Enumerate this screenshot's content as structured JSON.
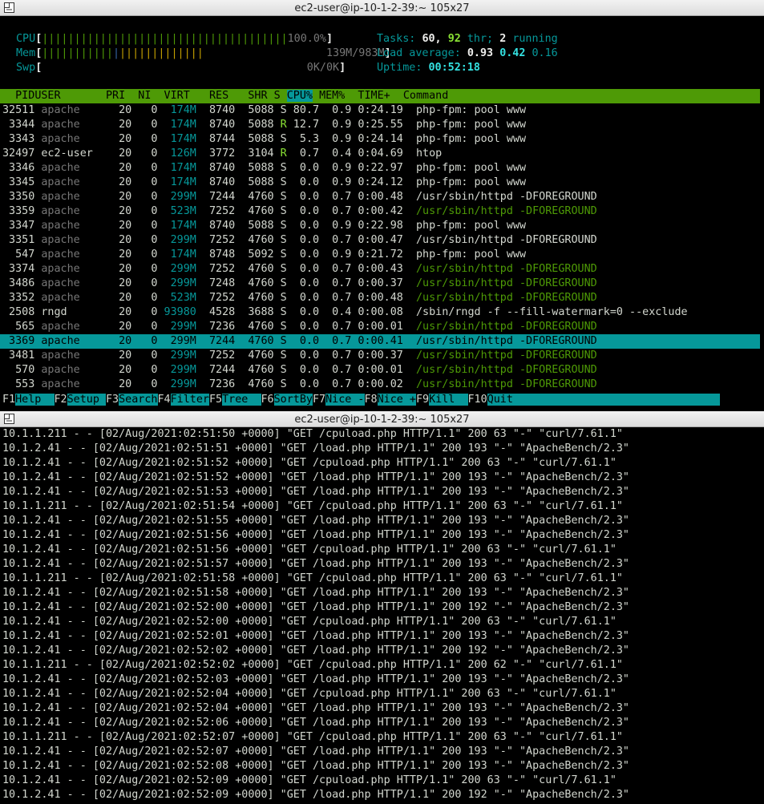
{
  "windows": [
    {
      "title": "ec2-user@ip-10-1-2-39:~ 105x27"
    },
    {
      "title": "ec2-user@ip-10-1-2-39:~ 105x27"
    }
  ],
  "htop": {
    "meters": {
      "cpu": {
        "label": "CPU",
        "bar": "||||||||||||||||||||||||||||||||||||||",
        "value": "100.0%"
      },
      "mem": {
        "label": "Mem",
        "bar_green": "|||||||||||",
        "bar_blue": "|",
        "bar_yellow": "|||||||||||||",
        "value": "139M/983M"
      },
      "swp": {
        "label": "Swp",
        "value": "0K/0K"
      }
    },
    "tasks": {
      "label": "Tasks:",
      "count": "60,",
      "threads": "92",
      "thr_label": "thr;",
      "running": "2",
      "running_label": "running"
    },
    "load": {
      "label": "Load average:",
      "one": "0.93",
      "five": "0.42",
      "fifteen": "0.16"
    },
    "uptime": {
      "label": "Uptime:",
      "value": "00:52:18"
    },
    "columns": [
      "  PID",
      "USER     ",
      "  PRI",
      "  NI",
      "  VIRT",
      "   RES",
      "   SHR",
      " S",
      "CPU%",
      "MEM%",
      "  TIME+ ",
      " Command"
    ],
    "processes": [
      [
        "32511",
        "apache",
        "20",
        "0",
        "174M",
        "8740",
        "5088",
        "S",
        "80.7",
        "0.9",
        "0:24.19",
        "php-fpm: pool www"
      ],
      [
        "3344",
        "apache",
        "20",
        "0",
        "174M",
        "8740",
        "5088",
        "R",
        "12.7",
        "0.9",
        "0:25.55",
        "php-fpm: pool www"
      ],
      [
        "3343",
        "apache",
        "20",
        "0",
        "174M",
        "8744",
        "5088",
        "S",
        "5.3",
        "0.9",
        "0:24.14",
        "php-fpm: pool www"
      ],
      [
        "32497",
        "ec2-user",
        "20",
        "0",
        "126M",
        "3772",
        "3104",
        "R",
        "0.7",
        "0.4",
        "0:04.69",
        "htop"
      ],
      [
        "3346",
        "apache",
        "20",
        "0",
        "174M",
        "8740",
        "5088",
        "S",
        "0.0",
        "0.9",
        "0:22.97",
        "php-fpm: pool www"
      ],
      [
        "3345",
        "apache",
        "20",
        "0",
        "174M",
        "8740",
        "5088",
        "S",
        "0.0",
        "0.9",
        "0:24.12",
        "php-fpm: pool www"
      ],
      [
        "3350",
        "apache",
        "20",
        "0",
        "299M",
        "7244",
        "4760",
        "S",
        "0.0",
        "0.7",
        "0:00.48",
        "/usr/sbin/httpd -DFOREGROUND"
      ],
      [
        "3359",
        "apache",
        "20",
        "0",
        "523M",
        "7252",
        "4760",
        "S",
        "0.0",
        "0.7",
        "0:00.42",
        "/usr/sbin/httpd -DFOREGROUND"
      ],
      [
        "3347",
        "apache",
        "20",
        "0",
        "174M",
        "8740",
        "5088",
        "S",
        "0.0",
        "0.9",
        "0:22.98",
        "php-fpm: pool www"
      ],
      [
        "3351",
        "apache",
        "20",
        "0",
        "299M",
        "7252",
        "4760",
        "S",
        "0.0",
        "0.7",
        "0:00.47",
        "/usr/sbin/httpd -DFOREGROUND"
      ],
      [
        "547",
        "apache",
        "20",
        "0",
        "174M",
        "8748",
        "5092",
        "S",
        "0.0",
        "0.9",
        "0:21.72",
        "php-fpm: pool www"
      ],
      [
        "3374",
        "apache",
        "20",
        "0",
        "299M",
        "7252",
        "4760",
        "S",
        "0.0",
        "0.7",
        "0:00.43",
        "/usr/sbin/httpd -DFOREGROUND"
      ],
      [
        "3486",
        "apache",
        "20",
        "0",
        "299M",
        "7248",
        "4760",
        "S",
        "0.0",
        "0.7",
        "0:00.37",
        "/usr/sbin/httpd -DFOREGROUND"
      ],
      [
        "3352",
        "apache",
        "20",
        "0",
        "523M",
        "7252",
        "4760",
        "S",
        "0.0",
        "0.7",
        "0:00.48",
        "/usr/sbin/httpd -DFOREGROUND"
      ],
      [
        "2508",
        "rngd",
        "20",
        "0",
        "93980",
        "4528",
        "3688",
        "S",
        "0.0",
        "0.4",
        "0:00.08",
        "/sbin/rngd -f --fill-watermark=0 --exclude"
      ],
      [
        "565",
        "apache",
        "20",
        "0",
        "299M",
        "7236",
        "4760",
        "S",
        "0.0",
        "0.7",
        "0:00.01",
        "/usr/sbin/httpd -DFOREGROUND"
      ],
      [
        "3369",
        "apache",
        "20",
        "0",
        "299M",
        "7244",
        "4760",
        "S",
        "0.0",
        "0.7",
        "0:00.41",
        "/usr/sbin/httpd -DFOREGROUND"
      ],
      [
        "3481",
        "apache",
        "20",
        "0",
        "299M",
        "7252",
        "4760",
        "S",
        "0.0",
        "0.7",
        "0:00.37",
        "/usr/sbin/httpd -DFOREGROUND"
      ],
      [
        "570",
        "apache",
        "20",
        "0",
        "299M",
        "7244",
        "4760",
        "S",
        "0.0",
        "0.7",
        "0:00.01",
        "/usr/sbin/httpd -DFOREGROUND"
      ],
      [
        "553",
        "apache",
        "20",
        "0",
        "299M",
        "7236",
        "4760",
        "S",
        "0.0",
        "0.7",
        "0:00.02",
        "/usr/sbin/httpd -DFOREGROUND"
      ]
    ],
    "selected_pid": "3369",
    "fkeys": [
      {
        "key": "F1",
        "label": "Help  "
      },
      {
        "key": "F2",
        "label": "Setup "
      },
      {
        "key": "F3",
        "label": "Search"
      },
      {
        "key": "F4",
        "label": "Filter"
      },
      {
        "key": "F5",
        "label": "Tree  "
      },
      {
        "key": "F6",
        "label": "SortBy"
      },
      {
        "key": "F7",
        "label": "Nice -"
      },
      {
        "key": "F8",
        "label": "Nice +"
      },
      {
        "key": "F9",
        "label": "Kill  "
      },
      {
        "key": "F10",
        "label": "Quit"
      }
    ]
  },
  "log_lines": [
    "10.1.1.211 - - [02/Aug/2021:02:51:50 +0000] \"GET /cpuload.php HTTP/1.1\" 200 63 \"-\" \"curl/7.61.1\"",
    "10.1.2.41 - - [02/Aug/2021:02:51:51 +0000] \"GET /load.php HTTP/1.1\" 200 193 \"-\" \"ApacheBench/2.3\"",
    "10.1.2.41 - - [02/Aug/2021:02:51:52 +0000] \"GET /cpuload.php HTTP/1.1\" 200 63 \"-\" \"curl/7.61.1\"",
    "10.1.2.41 - - [02/Aug/2021:02:51:52 +0000] \"GET /load.php HTTP/1.1\" 200 193 \"-\" \"ApacheBench/2.3\"",
    "10.1.2.41 - - [02/Aug/2021:02:51:53 +0000] \"GET /load.php HTTP/1.1\" 200 193 \"-\" \"ApacheBench/2.3\"",
    "10.1.1.211 - - [02/Aug/2021:02:51:54 +0000] \"GET /cpuload.php HTTP/1.1\" 200 63 \"-\" \"curl/7.61.1\"",
    "10.1.2.41 - - [02/Aug/2021:02:51:55 +0000] \"GET /load.php HTTP/1.1\" 200 193 \"-\" \"ApacheBench/2.3\"",
    "10.1.2.41 - - [02/Aug/2021:02:51:56 +0000] \"GET /load.php HTTP/1.1\" 200 193 \"-\" \"ApacheBench/2.3\"",
    "10.1.2.41 - - [02/Aug/2021:02:51:56 +0000] \"GET /cpuload.php HTTP/1.1\" 200 63 \"-\" \"curl/7.61.1\"",
    "10.1.2.41 - - [02/Aug/2021:02:51:57 +0000] \"GET /load.php HTTP/1.1\" 200 193 \"-\" \"ApacheBench/2.3\"",
    "10.1.1.211 - - [02/Aug/2021:02:51:58 +0000] \"GET /cpuload.php HTTP/1.1\" 200 63 \"-\" \"curl/7.61.1\"",
    "10.1.2.41 - - [02/Aug/2021:02:51:58 +0000] \"GET /load.php HTTP/1.1\" 200 193 \"-\" \"ApacheBench/2.3\"",
    "10.1.2.41 - - [02/Aug/2021:02:52:00 +0000] \"GET /load.php HTTP/1.1\" 200 192 \"-\" \"ApacheBench/2.3\"",
    "10.1.2.41 - - [02/Aug/2021:02:52:00 +0000] \"GET /cpuload.php HTTP/1.1\" 200 63 \"-\" \"curl/7.61.1\"",
    "10.1.2.41 - - [02/Aug/2021:02:52:01 +0000] \"GET /load.php HTTP/1.1\" 200 193 \"-\" \"ApacheBench/2.3\"",
    "10.1.2.41 - - [02/Aug/2021:02:52:02 +0000] \"GET /load.php HTTP/1.1\" 200 192 \"-\" \"ApacheBench/2.3\"",
    "10.1.1.211 - - [02/Aug/2021:02:52:02 +0000] \"GET /cpuload.php HTTP/1.1\" 200 62 \"-\" \"curl/7.61.1\"",
    "10.1.2.41 - - [02/Aug/2021:02:52:03 +0000] \"GET /load.php HTTP/1.1\" 200 193 \"-\" \"ApacheBench/2.3\"",
    "10.1.2.41 - - [02/Aug/2021:02:52:04 +0000] \"GET /cpuload.php HTTP/1.1\" 200 63 \"-\" \"curl/7.61.1\"",
    "10.1.2.41 - - [02/Aug/2021:02:52:04 +0000] \"GET /load.php HTTP/1.1\" 200 193 \"-\" \"ApacheBench/2.3\"",
    "10.1.2.41 - - [02/Aug/2021:02:52:06 +0000] \"GET /load.php HTTP/1.1\" 200 193 \"-\" \"ApacheBench/2.3\"",
    "10.1.1.211 - - [02/Aug/2021:02:52:07 +0000] \"GET /cpuload.php HTTP/1.1\" 200 63 \"-\" \"curl/7.61.1\"",
    "10.1.2.41 - - [02/Aug/2021:02:52:07 +0000] \"GET /load.php HTTP/1.1\" 200 193 \"-\" \"ApacheBench/2.3\"",
    "10.1.2.41 - - [02/Aug/2021:02:52:08 +0000] \"GET /load.php HTTP/1.1\" 200 193 \"-\" \"ApacheBench/2.3\"",
    "10.1.2.41 - - [02/Aug/2021:02:52:09 +0000] \"GET /cpuload.php HTTP/1.1\" 200 63 \"-\" \"curl/7.61.1\"",
    "10.1.2.41 - - [02/Aug/2021:02:52:09 +0000] \"GET /load.php HTTP/1.1\" 200 192 \"-\" \"ApacheBench/2.3\""
  ],
  "colors": {
    "accent_green": "#4e9a06",
    "accent_cyan": "#06989a",
    "background": "#000000"
  },
  "icons": [
    "terminal-window-icon"
  ]
}
